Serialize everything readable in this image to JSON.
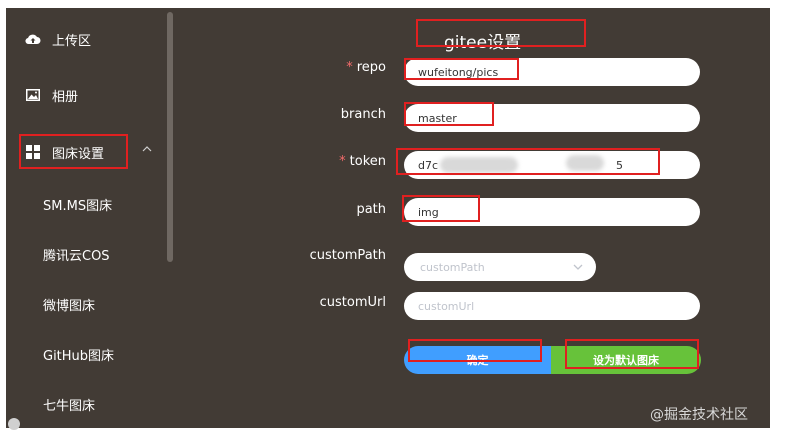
{
  "sidebar": {
    "items": [
      {
        "label": "上传区",
        "icon": "cloud-upload-icon"
      },
      {
        "label": "相册",
        "icon": "image-icon"
      },
      {
        "label": "图床设置",
        "icon": "grid-icon"
      },
      {
        "label": "SM.MS图床"
      },
      {
        "label": "腾讯云COS"
      },
      {
        "label": "微博图床"
      },
      {
        "label": "GitHub图床"
      },
      {
        "label": "七牛图床"
      }
    ],
    "expand_icon": "chevron-up-icon"
  },
  "form": {
    "title": "gitee设置",
    "fields": {
      "repo": {
        "label": "repo",
        "required": true,
        "value": "wufeitong/pics"
      },
      "branch": {
        "label": "branch",
        "required": false,
        "value": "master"
      },
      "token": {
        "label": "token",
        "required": true,
        "value_start": "d7c",
        "value_end": "5"
      },
      "path": {
        "label": "path",
        "required": false,
        "value": "img"
      },
      "customPath": {
        "label": "customPath",
        "placeholder": "customPath"
      },
      "customUrl": {
        "label": "customUrl",
        "placeholder": "customUrl"
      }
    },
    "buttons": {
      "confirm": "确定",
      "set_default": "设为默认图床"
    }
  },
  "watermark": "@掘金技术社区",
  "colors": {
    "background": "#423b35",
    "highlight_box": "#e02020",
    "confirm_button": "#409eff",
    "default_button": "#67c23a",
    "required_mark": "#f56c6c"
  }
}
